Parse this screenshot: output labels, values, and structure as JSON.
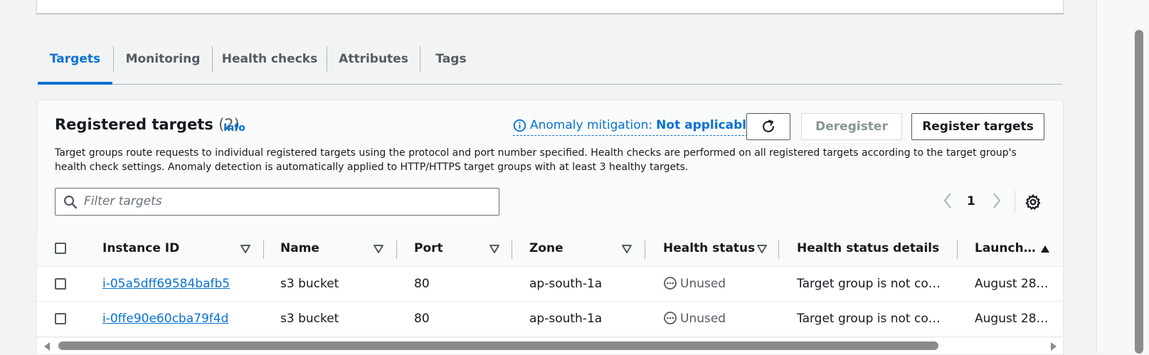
{
  "tabs": [
    {
      "label": "Targets",
      "active": true
    },
    {
      "label": "Monitoring"
    },
    {
      "label": "Health checks"
    },
    {
      "label": "Attributes"
    },
    {
      "label": "Tags"
    }
  ],
  "panel": {
    "title": "Registered targets",
    "count": "(2)",
    "info_label": "Info",
    "anomaly_label": "Anomaly mitigation:",
    "anomaly_value": "Not applicable",
    "refresh_icon": "refresh-icon",
    "deregister_label": "Deregister",
    "register_label": "Register targets",
    "description": "Target groups route requests to individual registered targets using the protocol and port number specified. Health checks are performed on all registered targets according to the target group's health check settings. Anomaly detection is automatically applied to HTTP/HTTPS target groups with at least 3 healthy targets.",
    "filter_placeholder": "Filter targets",
    "page_number": "1"
  },
  "table": {
    "columns": [
      "Instance ID",
      "Name",
      "Port",
      "Zone",
      "Health status",
      "Health status details",
      "Launch…"
    ],
    "rows": [
      {
        "instance_id": "i-05a5dff69584bafb5",
        "name": "s3 bucket",
        "port": "80",
        "zone": "ap-south-1a",
        "health_status": "Unused",
        "health_details": "Target group is not co…",
        "launch": "August 28…"
      },
      {
        "instance_id": "i-0ffe90e60cba79f4d",
        "name": "s3 bucket",
        "port": "80",
        "zone": "ap-south-1a",
        "health_status": "Unused",
        "health_details": "Target group is not co…",
        "launch": "August 28…"
      }
    ]
  },
  "colors": {
    "accent": "#0972d3",
    "text": "#16191f",
    "muted": "#545b64",
    "background": "#f2f3f3"
  }
}
